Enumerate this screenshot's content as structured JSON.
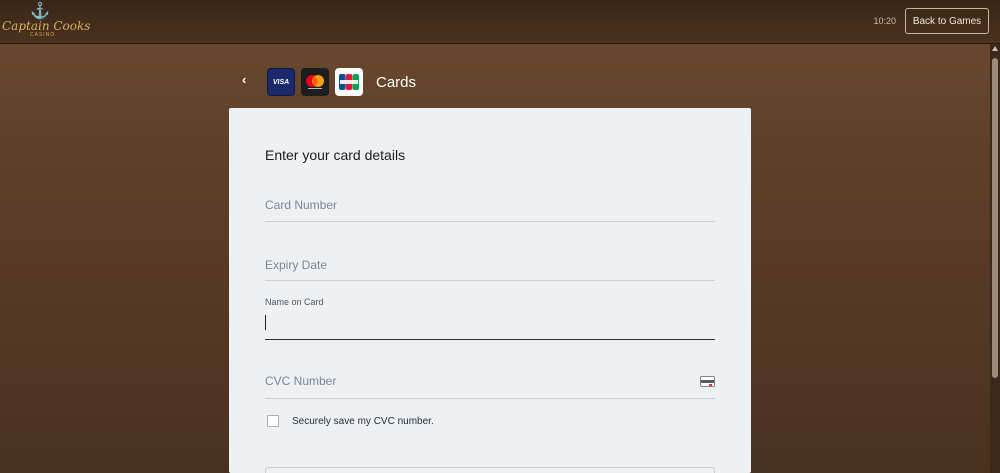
{
  "header": {
    "logo_name": "Captain Cooks",
    "logo_sub": "CASINO",
    "clock": "10:20",
    "back_button": "Back to Games"
  },
  "payment_method": {
    "title": "Cards",
    "back_icon": "chevron-left-icon",
    "brands": [
      "visa",
      "mastercard",
      "jcb"
    ],
    "visa_label": "VISA"
  },
  "form": {
    "title": "Enter your card details",
    "card_number_placeholder": "Card Number",
    "expiry_placeholder": "Expiry Date",
    "name_label": "Name on Card",
    "name_value": "",
    "cvc_placeholder": "CVC Number",
    "save_cvc_label": "Securely save my CVC number.",
    "save_cvc_checked": false
  },
  "colors": {
    "background": "#5b3e28",
    "panel": "#eef1f3",
    "accent_gold": "#d6b25c"
  }
}
